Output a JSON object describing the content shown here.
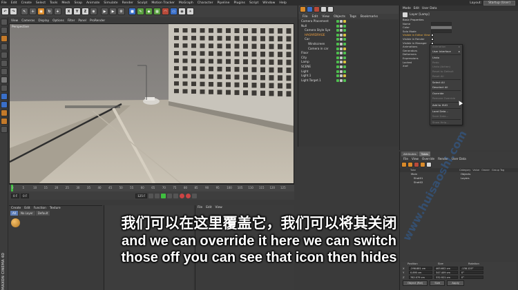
{
  "menubar": {
    "items": [
      "File",
      "Edit",
      "Create",
      "Select",
      "Tools",
      "Mesh",
      "Snap",
      "Animate",
      "Simulate",
      "Render",
      "Sculpt",
      "Motion Tracker",
      "MoGraph",
      "Character",
      "Pipeline",
      "Plugins",
      "Script",
      "Window",
      "Help"
    ],
    "layout_label": "Layout:",
    "layout_value": "Startup (User)"
  },
  "toolbar": {
    "xyz": [
      "X",
      "Y",
      "Z"
    ]
  },
  "viewport": {
    "menu": [
      "View",
      "Cameras",
      "Display",
      "Options",
      "Filter",
      "Panel",
      "ProRender"
    ],
    "label": "Perspective"
  },
  "timeline": {
    "ticks": [
      "0",
      "5",
      "10",
      "15",
      "20",
      "25",
      "30",
      "35",
      "40",
      "45",
      "50",
      "55",
      "60",
      "65",
      "70",
      "75",
      "80",
      "85",
      "90",
      "95",
      "100",
      "105",
      "110",
      "115",
      "120",
      "125"
    ],
    "start_field": "0 F",
    "end_field": "125 F"
  },
  "material_panel": {
    "menu": [
      "Create",
      "Edit",
      "Function",
      "Texture"
    ],
    "tabs": [
      "All",
      "No Layer",
      "Default"
    ]
  },
  "object_manager": {
    "menu": [
      "File",
      "Edit",
      "View",
      "Objects",
      "Tags",
      "Bookmarks"
    ],
    "rows": [
      {
        "label": "Camera Placement",
        "indent": 0,
        "hl": false
      },
      {
        "label": "Null",
        "indent": 0,
        "hl": false
      },
      {
        "label": "Camera Style Sye",
        "indent": 1,
        "hl": false
      },
      {
        "label": "HAOARDRAGE",
        "indent": 1,
        "hl": true
      },
      {
        "label": "Car",
        "indent": 1,
        "hl": false
      },
      {
        "label": "Windscreen",
        "indent": 2,
        "hl": false
      },
      {
        "label": "Camera in car",
        "indent": 2,
        "hl": false
      },
      {
        "label": "Floor",
        "indent": 0,
        "hl": false
      },
      {
        "label": "City",
        "indent": 0,
        "hl": false
      },
      {
        "label": "Lamp",
        "indent": 0,
        "hl": false
      },
      {
        "label": "SCENE",
        "indent": 0,
        "hl": false
      },
      {
        "label": "Light",
        "indent": 0,
        "hl": false
      },
      {
        "label": "Light.1",
        "indent": 0,
        "hl": false
      },
      {
        "label": "Light.Target.1",
        "indent": 0,
        "hl": false
      }
    ]
  },
  "layer_panel": {
    "menu": [
      "Mode",
      "Edit",
      "User Data"
    ],
    "title": "Layer [Lamp]",
    "section": "Basic Properties",
    "rows": [
      {
        "label": "Name",
        "kind": "val",
        "sel": false
      },
      {
        "label": "Color",
        "kind": "color",
        "sel": false
      },
      {
        "label": "Solo Mode",
        "kind": "val",
        "sel": false
      },
      {
        "label": "Visible in Editor View",
        "kind": "chk",
        "sel": true
      },
      {
        "label": "Visible in Render",
        "kind": "chk",
        "sel": false
      },
      {
        "label": "Visible in Manager",
        "kind": "chk",
        "sel": false
      },
      {
        "label": "Animations",
        "kind": "chk",
        "sel": false
      },
      {
        "label": "Generators",
        "kind": "chk",
        "sel": false
      },
      {
        "label": "Deformers",
        "kind": "chk",
        "sel": false
      },
      {
        "label": "Expressions",
        "kind": "chk",
        "sel": false
      },
      {
        "label": "Locked",
        "kind": "chk",
        "sel": false
      },
      {
        "label": "Xref",
        "kind": "chk",
        "sel": false
      }
    ]
  },
  "context_menu": {
    "items": [
      {
        "label": "Animation",
        "dim": true,
        "arrow": true
      },
      {
        "label": "User Interface",
        "dim": false,
        "arrow": true
      },
      {
        "sep": true
      },
      {
        "label": "Undo",
        "dim": false
      },
      {
        "label": "Redo",
        "dim": true
      },
      {
        "label": "Undo (Action)",
        "dim": true
      },
      {
        "label": "Reset to Default",
        "dim": true
      },
      {
        "label": "Reset All",
        "dim": true
      },
      {
        "sep": true
      },
      {
        "label": "Select All",
        "dim": false
      },
      {
        "label": "Deselect All",
        "dim": false
      },
      {
        "sep": true
      },
      {
        "label": "Override",
        "dim": false
      },
      {
        "label": "Remove Override",
        "dim": true
      },
      {
        "sep": true
      },
      {
        "label": "Add to HUD",
        "dim": false
      },
      {
        "sep": true
      },
      {
        "label": "Load Data...",
        "dim": false
      },
      {
        "label": "Save Data...",
        "dim": true
      },
      {
        "sep": true
      },
      {
        "label": "Show Help...",
        "dim": true
      }
    ]
  },
  "take_manager": {
    "tabs": [
      "Attributes",
      "Takes"
    ],
    "menu": [
      "File",
      "View",
      "Override",
      "Render",
      "User Data"
    ],
    "columns": [
      "Take",
      "Category",
      "Value",
      "Owner",
      "Group Tag"
    ],
    "rows": [
      {
        "label": "Main",
        "cat": "Objects"
      },
      {
        "label": "Shot01",
        "cat": "Layers"
      },
      {
        "label": "Shot02",
        "cat": ""
      }
    ]
  },
  "coords": {
    "headers": [
      "Position",
      "Size",
      "Rotation"
    ],
    "rows": [
      {
        "axis": "X",
        "pos": "-298.881 cm",
        "size": "463.602 cm",
        "rot": "-138.125°"
      },
      {
        "axis": "Y",
        "pos": "0.895 cm",
        "size": "347.409 cm",
        "rot": "0°"
      },
      {
        "axis": "Z",
        "pos": "782.079 cm",
        "size": "332.921 cm",
        "rot": "0°"
      }
    ],
    "mode": "Object (Rel)",
    "size_mode": "Size",
    "apply": "Apply"
  },
  "brand": "MAXON CINEMA 4D",
  "watermark": "www.huisaoshi.com",
  "subtitles": {
    "cn": "我们可以在这里覆盖它，我们可以将其关闭",
    "en1": "and we can override it here we can switch",
    "en2": "those off you can see that icon then hides"
  }
}
